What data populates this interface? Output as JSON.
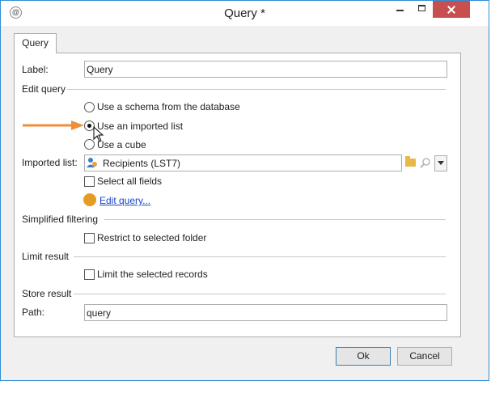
{
  "window": {
    "title": "Query *",
    "app_icon": "@"
  },
  "tab": {
    "label": "Query"
  },
  "label_row": {
    "label": "Label:",
    "value": "Query"
  },
  "edit_query": {
    "section": "Edit query",
    "options": [
      {
        "label": "Use a schema from the database",
        "selected": false
      },
      {
        "label": "Use an imported list",
        "selected": true
      },
      {
        "label": "Use a cube",
        "selected": false
      }
    ],
    "imported_list_label": "Imported list:",
    "imported_list_value": "Recipients (LST7)",
    "select_all_label": "Select all fields",
    "edit_link": "Edit query...",
    "link_color": "#1a45c8",
    "dot_color": "#e59c25"
  },
  "simplified_filtering": {
    "section": "Simplified filtering",
    "checkbox_label": "Restrict to selected folder"
  },
  "limit_result": {
    "section": "Limit result",
    "checkbox_label": "Limit the selected records"
  },
  "store_result": {
    "section": "Store result",
    "path_label": "Path:",
    "path_value": "query"
  },
  "buttons": {
    "ok": "Ok",
    "cancel": "Cancel"
  },
  "colors": {
    "accent_border": "#2f8fd6",
    "close_button": "#c74f4f",
    "arrow": "#ee8f3a"
  }
}
